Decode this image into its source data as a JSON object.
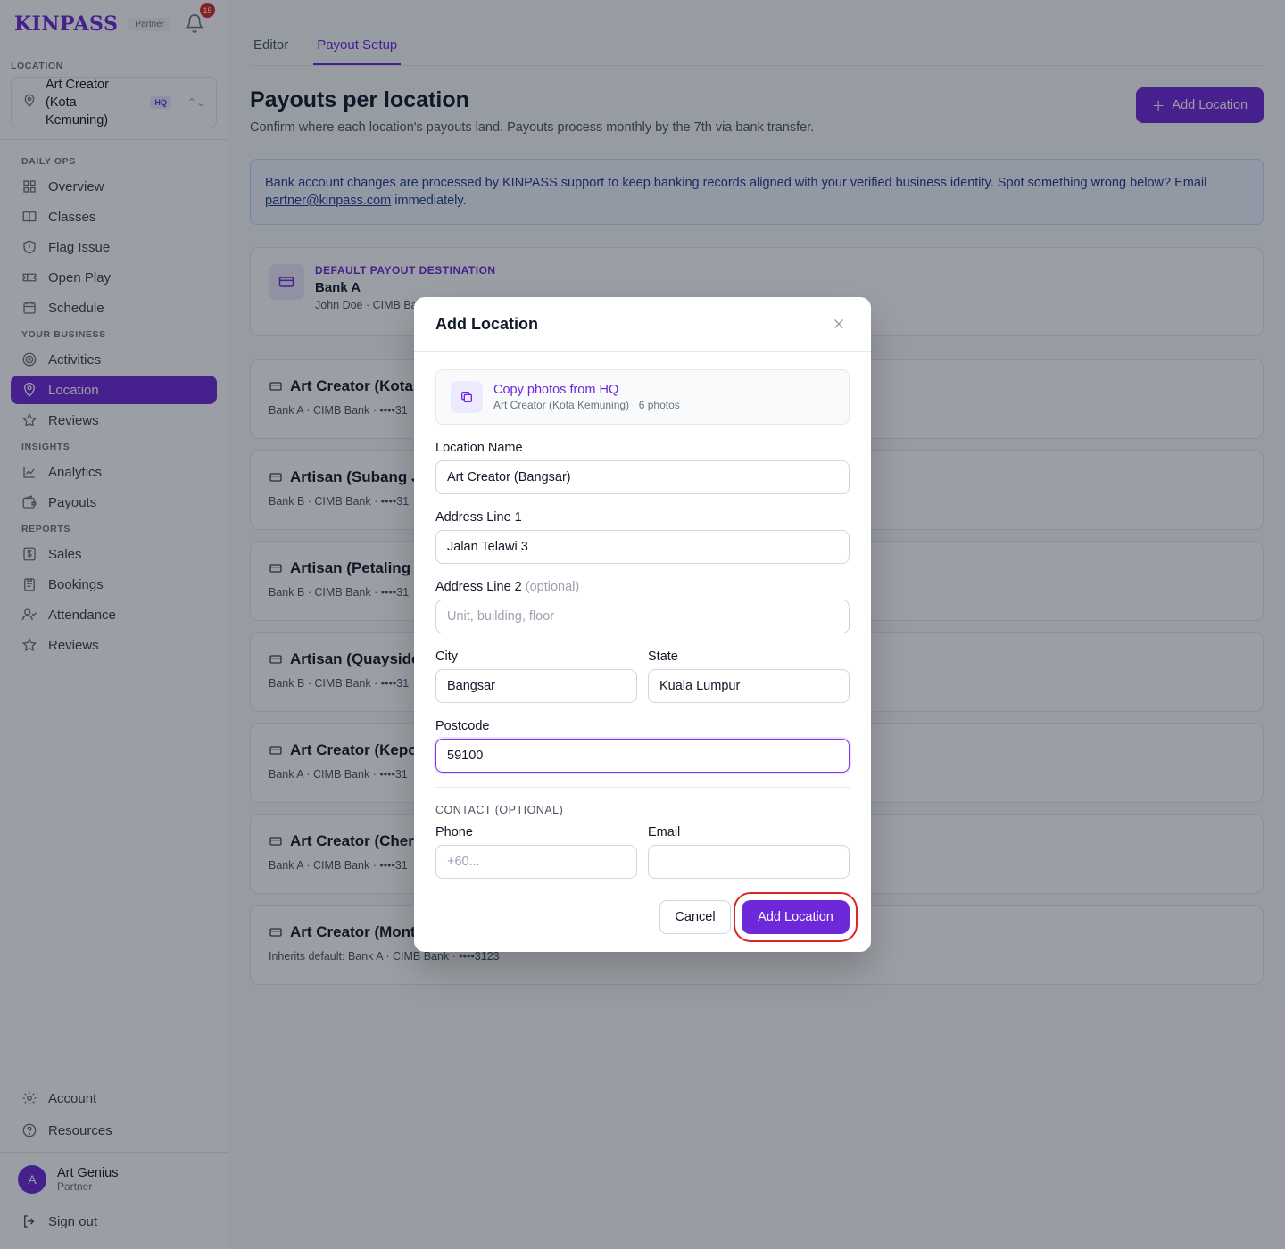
{
  "brand": {
    "name": "KINPASS",
    "tag": "Partner",
    "notification_count": "15"
  },
  "location_selector": {
    "label": "LOCATION",
    "name": "Art Creator (Kota Kemuning)",
    "badge": "HQ"
  },
  "sidebar": {
    "groups": [
      {
        "label": "DAILY OPS",
        "items": [
          {
            "label": "Overview",
            "icon": "grid-icon"
          },
          {
            "label": "Classes",
            "icon": "book-icon"
          },
          {
            "label": "Flag Issue",
            "icon": "shield-icon"
          },
          {
            "label": "Open Play",
            "icon": "ticket-icon"
          },
          {
            "label": "Schedule",
            "icon": "calendar-icon"
          }
        ]
      },
      {
        "label": "YOUR BUSINESS",
        "items": [
          {
            "label": "Activities",
            "icon": "target-icon"
          },
          {
            "label": "Location",
            "icon": "map-pin-icon",
            "active": true
          },
          {
            "label": "Reviews",
            "icon": "star-icon"
          }
        ]
      },
      {
        "label": "INSIGHTS",
        "items": [
          {
            "label": "Analytics",
            "icon": "chart-icon"
          },
          {
            "label": "Payouts",
            "icon": "wallet-icon"
          }
        ]
      },
      {
        "label": "REPORTS",
        "items": [
          {
            "label": "Sales",
            "icon": "dollar-icon"
          },
          {
            "label": "Bookings",
            "icon": "clipboard-icon"
          },
          {
            "label": "Attendance",
            "icon": "user-check-icon"
          },
          {
            "label": "Reviews",
            "icon": "star-icon"
          }
        ]
      }
    ],
    "bottom": [
      {
        "label": "Account",
        "icon": "gear-icon"
      },
      {
        "label": "Resources",
        "icon": "help-icon"
      }
    ],
    "user": {
      "initial": "A",
      "name": "Art Genius",
      "role": "Partner"
    },
    "signout": "Sign out"
  },
  "tabs": [
    {
      "label": "Editor"
    },
    {
      "label": "Payout Setup",
      "active": true
    }
  ],
  "page": {
    "title": "Payouts per location",
    "subtitle": "Confirm where each location's payouts land. Payouts process monthly by the 7th via bank transfer.",
    "add_button": "Add Location",
    "banner_text": "Bank account changes are processed by KINPASS support to keep banking records aligned with your verified business identity. Spot something wrong below? Email ",
    "banner_email": "partner@kinpass.com",
    "banner_suffix": " immediately."
  },
  "default_payout": {
    "eyebrow": "DEFAULT PAYOUT DESTINATION",
    "bank": "Bank A",
    "detail": "John Doe · CIMB Ba"
  },
  "locations": [
    {
      "name": "Art Creator (Kota K",
      "detail": "Bank A · CIMB Bank · ••••31"
    },
    {
      "name": "Artisan (Subang J",
      "detail": "Bank B · CIMB Bank · ••••31"
    },
    {
      "name": "Artisan (Petaling J",
      "detail": "Bank B · CIMB Bank · ••••31"
    },
    {
      "name": "Artisan (Quayside",
      "detail": "Bank B · CIMB Bank · ••••31"
    },
    {
      "name": "Art Creator (Kepor",
      "detail": "Bank A · CIMB Bank · ••••31"
    },
    {
      "name": "Art Creator (Chera",
      "detail": "Bank A · CIMB Bank · ••••31"
    },
    {
      "name": "Art Creator (Mont",
      "detail": "Inherits default: Bank A · CIMB Bank · ••••3123"
    }
  ],
  "modal": {
    "title": "Add Location",
    "copy_title": "Copy photos from HQ",
    "copy_sub": "Art Creator (Kota Kemuning) · 6 photos",
    "location_name_label": "Location Name",
    "location_name_value": "Art Creator (Bangsar)",
    "address1_label": "Address Line 1",
    "address1_value": "Jalan Telawi 3",
    "address2_label": "Address Line 2",
    "address2_optional": "(optional)",
    "address2_placeholder": "Unit, building, floor",
    "city_label": "City",
    "city_value": "Bangsar",
    "state_label": "State",
    "state_value": "Kuala Lumpur",
    "postcode_label": "Postcode",
    "postcode_value": "59100",
    "contact_label": "CONTACT (OPTIONAL)",
    "phone_label": "Phone",
    "phone_placeholder": "+60...",
    "email_label": "Email",
    "cancel": "Cancel",
    "submit": "Add Location"
  },
  "colors": {
    "accent": "#6d28d9",
    "highlight": "#dc2626"
  }
}
